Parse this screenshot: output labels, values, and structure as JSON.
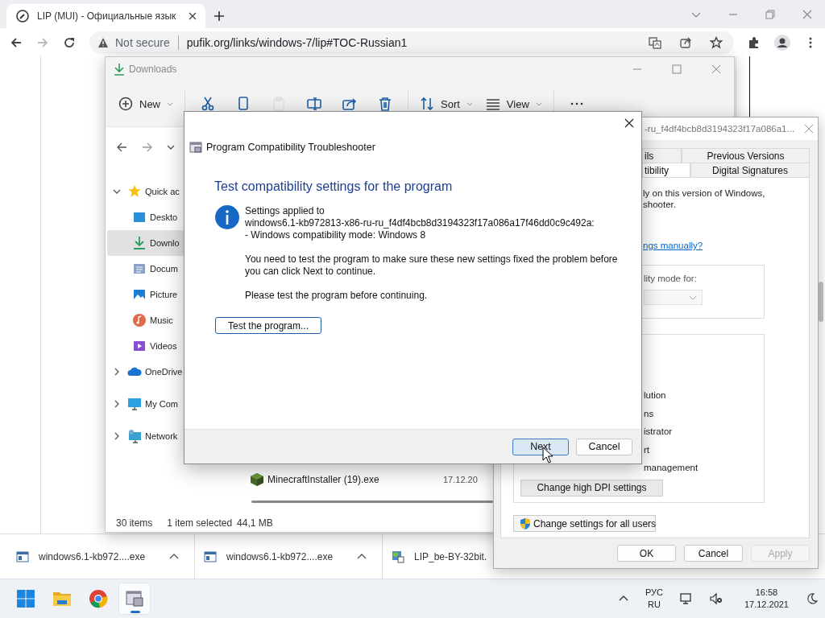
{
  "browser": {
    "tab": {
      "title": "LIP (MUI) - Официальные язык"
    },
    "address": {
      "security": "Not secure",
      "url": "pufik.org/links/windows-7/lip#TOC-Russian1"
    }
  },
  "explorer": {
    "title": "Downloads",
    "toolbar": [
      {
        "kind": "new",
        "label": "New",
        "disabled": false
      },
      {
        "kind": "cut",
        "disabled": false
      },
      {
        "kind": "copy",
        "disabled": false
      },
      {
        "kind": "paste",
        "disabled": true
      },
      {
        "kind": "rename",
        "disabled": false
      },
      {
        "kind": "share",
        "disabled": false
      },
      {
        "kind": "delete",
        "disabled": false
      },
      {
        "kind": "sort",
        "label": "Sort",
        "disabled": false
      },
      {
        "kind": "view",
        "label": "View",
        "disabled": false
      },
      {
        "kind": "more",
        "disabled": false
      }
    ],
    "nav": [
      {
        "label": "Quick ac",
        "kind": "star",
        "expanded": true,
        "selected": false,
        "children": [
          {
            "label": "Deskto",
            "kind": "desktop",
            "selected": false
          },
          {
            "label": "Downlo",
            "kind": "download",
            "selected": true
          },
          {
            "label": "Docum",
            "kind": "documents",
            "selected": false
          },
          {
            "label": "Picture",
            "kind": "pictures",
            "selected": false
          },
          {
            "label": "Music",
            "kind": "music",
            "selected": false
          },
          {
            "label": "Videos",
            "kind": "videos",
            "selected": false
          }
        ]
      },
      {
        "label": "OneDrive",
        "kind": "cloud",
        "expanded": false,
        "selected": false
      },
      {
        "label": "My Com",
        "kind": "computer",
        "expanded": false,
        "selected": false
      },
      {
        "label": "Network",
        "kind": "network",
        "expanded": false,
        "selected": false
      }
    ],
    "files": [
      {
        "name": "MinecraftInstaller (19).exe",
        "date": "17.12.20"
      }
    ],
    "status": {
      "count": "30 items",
      "selection": "1 item selected",
      "size": "44,1 MB"
    }
  },
  "properties": {
    "title": "-ru_f4df4bcb8d3194323f17a086a1...",
    "tab_rows": [
      {
        "tabs": [
          {
            "label": "ils",
            "selected": false
          },
          {
            "label": "Previous Versions",
            "selected": false
          }
        ]
      },
      {
        "tabs": [
          {
            "label": "tibility",
            "selected": true
          },
          {
            "label": "Digital Signatures",
            "selected": false
          }
        ]
      }
    ],
    "intro": [
      "ly on this version of Windows,",
      "shooter."
    ],
    "link": "ngs manually?",
    "mode_group": {
      "label": "lity mode for:",
      "dropdown": {
        "disabled": true
      }
    },
    "settings": [
      "lution",
      "ns",
      "istrator",
      "rt",
      "management"
    ],
    "dpi_button": "Change high DPI settings",
    "all_users_button": "Change settings for all users",
    "buttons": [
      {
        "label": "OK",
        "disabled": false
      },
      {
        "label": "Cancel",
        "disabled": false
      },
      {
        "label": "Apply",
        "disabled": true
      }
    ]
  },
  "troubleshooter": {
    "title": "Program Compatibility Troubleshooter",
    "heading": "Test compatibility settings for the program",
    "applied": [
      "Settings applied to",
      "windows6.1-kb972813-x86-ru-ru_f4df4bcb8d3194323f17a086a17f46dd0c9c492a:",
      "- Windows compatibility mode: Windows 8"
    ],
    "message": "You need to test the program to make sure these new settings fixed the problem before you can click Next to continue.",
    "prompt": "Please test the program before continuing.",
    "test_button": "Test the program...",
    "buttons": [
      {
        "label": "Next",
        "default": true
      },
      {
        "label": "Cancel",
        "default": false
      }
    ]
  },
  "downloads_bar": [
    {
      "name": "windows6.1-kb972....exe",
      "kind": "exe"
    },
    {
      "name": "windows6.1-kb972....exe",
      "kind": "exe"
    },
    {
      "name": "LIP_be-BY-32bit.",
      "kind": "package"
    }
  ],
  "taskbar": {
    "apps": [
      {
        "kind": "start",
        "selected": false
      },
      {
        "kind": "explorer",
        "selected": false
      },
      {
        "kind": "chrome",
        "selected": false
      },
      {
        "kind": "troubleshooter",
        "selected": true
      }
    ],
    "language": "РУС",
    "region": "RU",
    "time": "16:58",
    "date": "17.12.2021"
  }
}
